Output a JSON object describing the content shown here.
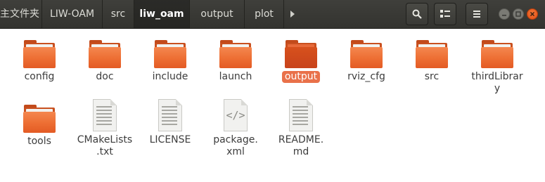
{
  "header": {
    "crumbs": [
      "主文件夹",
      "LIW-OAM",
      "src",
      "liw_oam",
      "output",
      "plot"
    ],
    "active_crumb": "liw_oam"
  },
  "icons": {
    "search": "search-icon",
    "view": "view-toggle-icon",
    "menu": "hamburger-menu-icon",
    "minimize": "minimize-icon",
    "maximize": "maximize-icon",
    "close": "close-icon"
  },
  "files": [
    {
      "name": "config",
      "type": "folder"
    },
    {
      "name": "doc",
      "type": "folder"
    },
    {
      "name": "include",
      "type": "folder"
    },
    {
      "name": "launch",
      "type": "folder"
    },
    {
      "name": "output",
      "type": "folder",
      "selected": true
    },
    {
      "name": "rviz_cfg",
      "type": "folder"
    },
    {
      "name": "src",
      "type": "folder"
    },
    {
      "name_line1": "thirdLibrar",
      "name_line2": "y",
      "type": "folder"
    },
    {
      "name": "tools",
      "type": "folder"
    },
    {
      "name_line1": "CMakeLists",
      "name_line2": ".txt",
      "type": "text"
    },
    {
      "name": "LICENSE",
      "type": "text"
    },
    {
      "name_line1": "package.",
      "name_line2": "xml",
      "type": "xml"
    },
    {
      "name_line1": "README.",
      "name_line2": "md",
      "type": "text"
    }
  ],
  "colors": {
    "accent": "#e9714a",
    "folder": "#ed6e33",
    "headerbar": "#3a3a36"
  }
}
